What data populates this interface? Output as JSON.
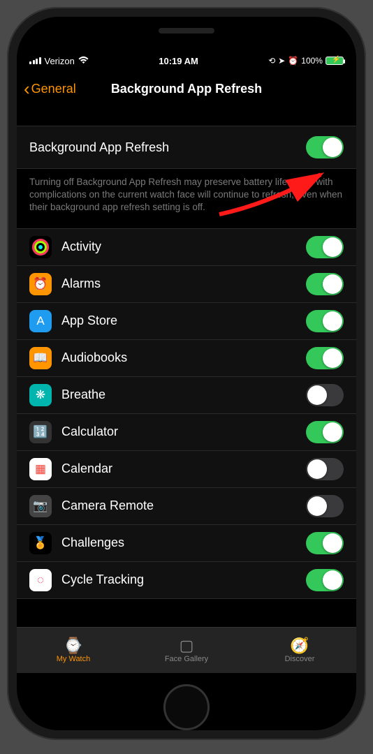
{
  "status": {
    "carrier": "Verizon",
    "time": "10:19 AM",
    "battery_pct": "100%"
  },
  "nav": {
    "back_label": "General",
    "title": "Background App Refresh"
  },
  "master": {
    "label": "Background App Refresh",
    "on": true,
    "help": "Turning off Background App Refresh may preserve battery life. Apps with complications on the current watch face will continue to refresh, even when their background app refresh setting is off."
  },
  "apps": [
    {
      "name": "Activity",
      "icon": "activity",
      "on": true
    },
    {
      "name": "Alarms",
      "icon": "alarms",
      "on": true
    },
    {
      "name": "App Store",
      "icon": "appstore",
      "on": true
    },
    {
      "name": "Audiobooks",
      "icon": "audiobooks",
      "on": true
    },
    {
      "name": "Breathe",
      "icon": "breathe",
      "on": false
    },
    {
      "name": "Calculator",
      "icon": "calculator",
      "on": true
    },
    {
      "name": "Calendar",
      "icon": "calendar",
      "on": false
    },
    {
      "name": "Camera Remote",
      "icon": "camera",
      "on": false
    },
    {
      "name": "Challenges",
      "icon": "challenges",
      "on": true
    },
    {
      "name": "Cycle Tracking",
      "icon": "cycle",
      "on": true
    }
  ],
  "tabs": [
    {
      "label": "My Watch",
      "active": true
    },
    {
      "label": "Face Gallery",
      "active": false
    },
    {
      "label": "Discover",
      "active": false
    }
  ],
  "icon_glyphs": {
    "alarms": "⏰",
    "appstore": "A",
    "audiobooks": "📖",
    "breathe": "❋",
    "calculator": "🔢",
    "calendar": "▦",
    "camera": "📷",
    "challenges": "🏅",
    "cycle": "◌"
  }
}
